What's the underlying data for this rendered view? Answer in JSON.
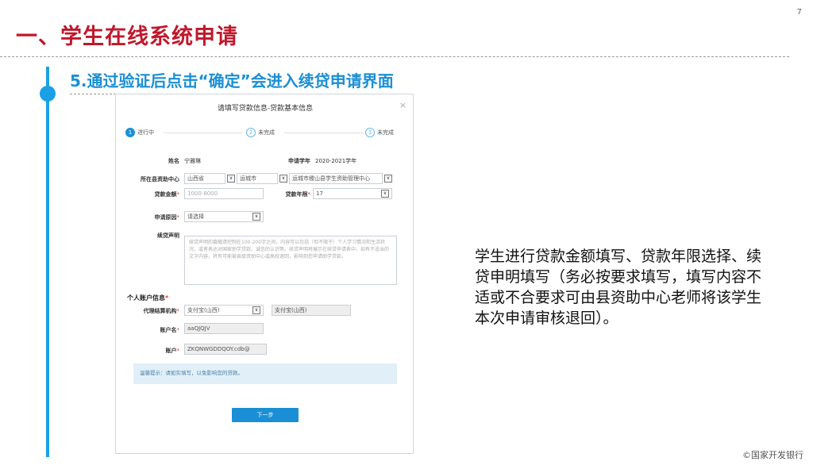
{
  "page": {
    "number": "7",
    "title": "一、学生在线系统申请",
    "step_title": "5.通过验证后点击“确定”会进入续贷申请界面",
    "description": "学生进行贷款金额填写、贷款年限选择、续贷申明填写（务必按要求填写，填写内容不适或不合要求可由县资助中心老师将该学生本次申请审核退回）。",
    "footer": "©国家开发银行"
  },
  "dialog": {
    "title": "请填写贷款信息-贷款基本信息",
    "close": "×",
    "steps": [
      {
        "index": "1",
        "label": "进行中"
      },
      {
        "index": "2",
        "label": "未完成"
      },
      {
        "index": "3",
        "label": "未完成"
      }
    ],
    "name_label": "姓名",
    "name_value": "宁雅琳",
    "year_label": "申请学年",
    "year_value": "2020-2021学年",
    "center_label": "所在县资助中心",
    "province": "山西省",
    "city": "运城市",
    "center": "运城市稷山县学生资助管理中心",
    "amount_label": "贷款金额",
    "amount_placeholder": "1000-8000",
    "term_label": "贷款年限",
    "term_value": "17",
    "reason_label": "申请原因",
    "reason_value": "请选择",
    "statement_label": "续贷声明",
    "statement_placeholder": "续贷声明的篇幅请控制在100-200字之间，内容可以包括（但不限于）个人学习情况和生活状况，或者表达对国家助学贷款、诚信的认识等。续贷声明将展示在续贷申请表中，如有不适当的文字内容，将有可能被县级资助中心或高校退回，影响到您申请助学贷款。",
    "account_section": "个人账户信息",
    "agency_label": "代理结算机构",
    "agency_value": "支付宝(山西)",
    "agency_display": "支付宝(山西)",
    "account_name_label": "账户名",
    "account_name_value": "aaQJQJV",
    "account_label": "账户",
    "account_value": "ZKQNWGDDQOY.cdb@",
    "notice": "温馨提示：请如实填写，以免影响您的贷款。",
    "next_button": "下一步",
    "arrow": "∨",
    "required_mark": "*"
  }
}
